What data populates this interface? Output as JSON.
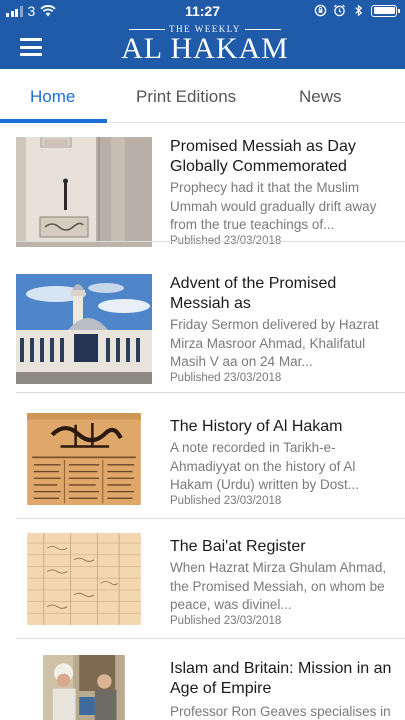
{
  "status_bar": {
    "carrier": "3",
    "time": "11:27"
  },
  "header": {
    "logo_top": "THE WEEKLY",
    "logo_main": "AL HAKAM"
  },
  "tabs": [
    {
      "label": "Home",
      "active": true
    },
    {
      "label": "Print Editions",
      "active": false
    },
    {
      "label": "News",
      "active": false
    }
  ],
  "articles": [
    {
      "title": "Promised Messiah as Day Globally  Commemorated",
      "excerpt": "Prophecy had it that the Muslim Ummah would gradually drift away from the true teachings of...",
      "date": "Published 23/03/2018",
      "image_icon": "minaret-wall-photo"
    },
    {
      "title": "Advent of the Promised Messiah as",
      "excerpt": "Friday Sermon delivered by Hazrat Mirza Masroor Ahmad, Khalifatul Masih V aa on 24 Mar...",
      "date": "Published 23/03/2018",
      "image_icon": "mosque-photo"
    },
    {
      "title": "The History of Al Hakam",
      "excerpt": "A note recorded in Tarikh-e-Ahmadiyyat on the history of Al Hakam (Urdu) written by Dost...",
      "date": "Published 23/03/2018",
      "image_icon": "old-newspaper-photo"
    },
    {
      "title": "The Bai'at Register",
      "excerpt": "When Hazrat Mirza Ghulam Ahmad, the Promised Messiah, on whom be peace, was divinel...",
      "date": "Published 23/03/2018",
      "image_icon": "register-page-photo"
    },
    {
      "title": "Islam and Britain: Mission in an Age of Empire",
      "excerpt": "Professor Ron Geaves specialises in the subject of the",
      "date": "",
      "image_icon": "meeting-photo"
    }
  ],
  "colors": {
    "header_bg": "#1f5ba8",
    "accent": "#1c6fd6",
    "title_text": "#1a1a1a",
    "meta_text": "#7a7a7a"
  }
}
